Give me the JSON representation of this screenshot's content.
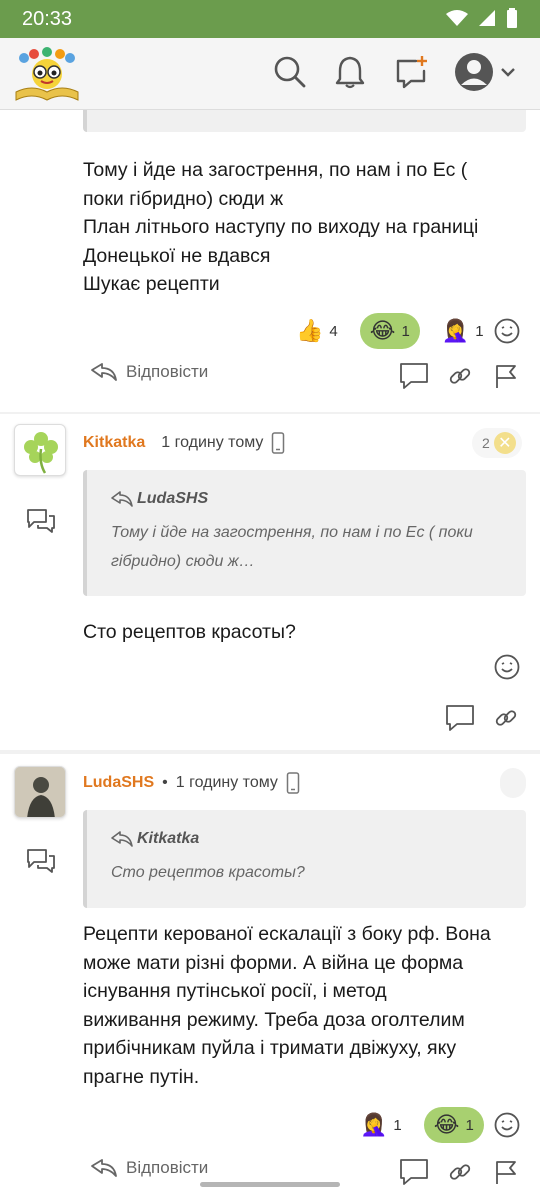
{
  "status": {
    "time": "20:33"
  },
  "comments": [
    {
      "text_lines": [
        "Тому і йде на загострення, по нам і по Ес (",
        "поки гібридно) сюди ж",
        "План літнього наступу по виходу на границі",
        "Донецької не вдався",
        "Шукає рецепти"
      ],
      "reactions": [
        {
          "emoji": "👍",
          "count": "4",
          "active": false
        },
        {
          "emoji": "😂",
          "count": "1",
          "active": true
        },
        {
          "emoji": "🤦‍♀️",
          "count": "1",
          "active": false
        }
      ],
      "reply_label": "Відповісти"
    },
    {
      "author": "Kitkatka",
      "dot": "",
      "time": "1 годину тому",
      "badge_count": "2",
      "quote_author": "LudaSHS",
      "quote_text": "Тому і йде на загострення, по нам і по Ес ( поки гібридно) сюди ж…",
      "text": "Сто рецептов красоты?"
    },
    {
      "author": "LudaSHS",
      "dot": "•",
      "time": "1 годину тому",
      "quote_author": "Kitkatka",
      "quote_text": "Сто рецептов красоты?",
      "text_lines": [
        "Рецепти керованої ескалації з боку рф. Вона",
        "може мати різні форми. А війна це форма",
        "існування путінської росії, і метод",
        "виживання режиму. Треба доза оголтелим",
        "прибічникам пуйла і тримати двіжуху, яку",
        "прагне путін."
      ],
      "reactions": [
        {
          "emoji": "🤦‍♀️",
          "count": "1",
          "active": false
        },
        {
          "emoji": "😂",
          "count": "1",
          "active": true
        }
      ],
      "reply_label": "Відповісти"
    }
  ]
}
